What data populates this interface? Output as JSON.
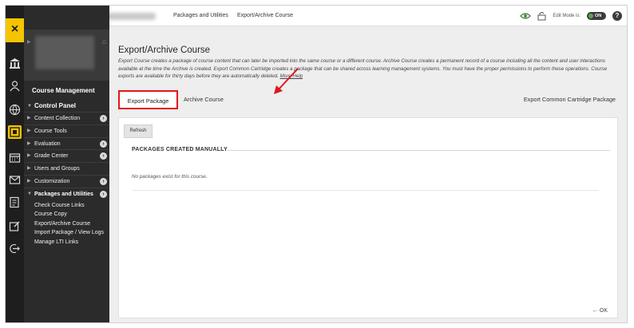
{
  "topbar": {
    "breadcrumb": [
      "Packages and Utilities",
      "Export/Archive Course"
    ],
    "edit_mode_label": "Edit Mode is:",
    "edit_mode_state": "ON",
    "help": "?"
  },
  "rail": {
    "close": "×",
    "icons": [
      "institution-icon",
      "user-icon",
      "globe-icon",
      "courses-icon",
      "calendar-icon",
      "mail-icon",
      "grades-icon",
      "edit-icon",
      "signout-icon"
    ]
  },
  "sidebar": {
    "heading": "Course Management",
    "control_panel": "Control Panel",
    "items": [
      {
        "label": "Content Collection",
        "go": true
      },
      {
        "label": "Course Tools",
        "go": false
      },
      {
        "label": "Evaluation",
        "go": true
      },
      {
        "label": "Grade Center",
        "go": true
      },
      {
        "label": "Users and Groups",
        "go": false
      },
      {
        "label": "Customization",
        "go": true
      },
      {
        "label": "Packages and Utilities",
        "go": true
      }
    ],
    "sub_items": [
      "Check Course Links",
      "Course Copy",
      "Export/Archive Course",
      "Import Package / View Logs",
      "Manage LTI Links"
    ]
  },
  "main": {
    "title": "Export/Archive Course",
    "description": "Export Course creates a package of course content that can later be imported into the same course or a different course. Archive Course creates a permanent record of a course including all the content and user interactions available at the time the Archive is created. Export Common Cartridge creates a package that can be shared across learning management systems. You must have the proper permissions to perform these operations. Course exports are available for thirty days before they are automatically deleted.",
    "more_help": "More Help",
    "tabs": {
      "export": "Export Package",
      "archive": "Archive Course",
      "common": "Export Common Cartridge Package"
    },
    "refresh": "Refresh",
    "section_title": "PACKAGES CREATED MANUALLY",
    "empty_text": "No packages exist for this course.",
    "ok": "OK",
    "ok_arrow": "←"
  },
  "colors": {
    "accent": "#f5c400",
    "highlight_border": "#e0161b",
    "sidebar_bg": "#2b2b2b"
  }
}
